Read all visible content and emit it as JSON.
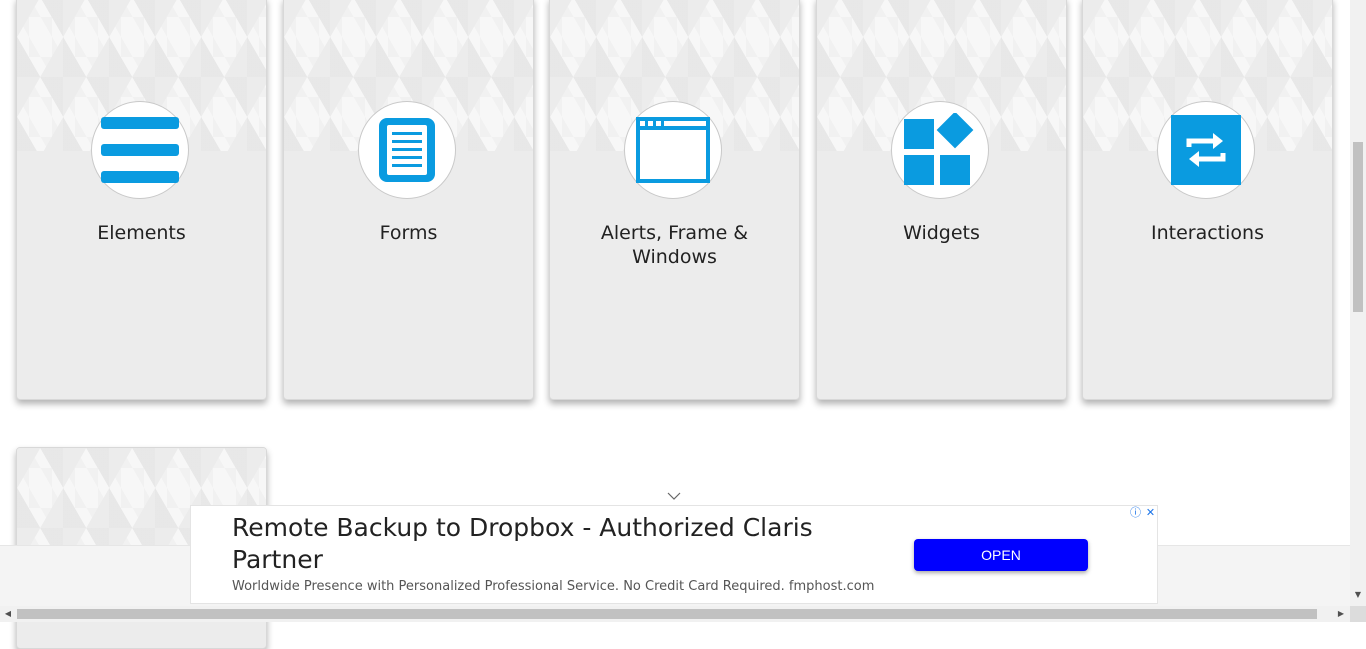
{
  "cards": [
    {
      "label": "Elements",
      "icon": "elements-icon"
    },
    {
      "label": "Forms",
      "icon": "forms-icon"
    },
    {
      "label": "Alerts, Frame & Windows",
      "icon": "window-icon"
    },
    {
      "label": "Widgets",
      "icon": "widgets-icon"
    },
    {
      "label": "Interactions",
      "icon": "interactions-icon"
    }
  ],
  "ad": {
    "title": "Remote Backup to Dropbox - Authorized Claris Partner",
    "description": "Worldwide Presence with Personalized Professional Service. No Credit Card Required. fmphost.com",
    "button": "OPEN",
    "button_color": "#0000ff"
  },
  "colors": {
    "accent": "#0a9be0",
    "card_bg": "#ececec"
  }
}
